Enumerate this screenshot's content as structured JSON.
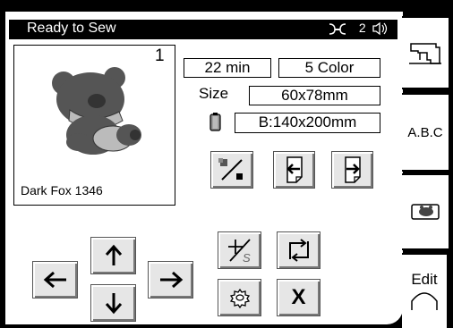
{
  "header": {
    "status": "Ready to Sew",
    "indicator": "2"
  },
  "pattern": {
    "number": "1",
    "name": "Dark Fox 1346"
  },
  "info": {
    "time": "22 min",
    "colors": "5 Color",
    "size_label": "Size",
    "size_value": "60x78mm",
    "hoop_value": "B:140x200mm"
  },
  "buttons": {
    "close_label": "X"
  },
  "tabs": {
    "abc_label": "A.B.C",
    "edit_label": "Edit"
  },
  "icons": {
    "presser-foot": "presser-foot-icon",
    "sound": "speaker-icon",
    "sewing-machine": "sewing-machine-icon",
    "hoop": "hoop-icon",
    "trace": "trace-icon",
    "prev": "arrow-left-page-icon",
    "next": "arrow-right-page-icon",
    "center": "center-needle-icon",
    "rotate": "rotate-icon",
    "settings": "gear-icon"
  }
}
